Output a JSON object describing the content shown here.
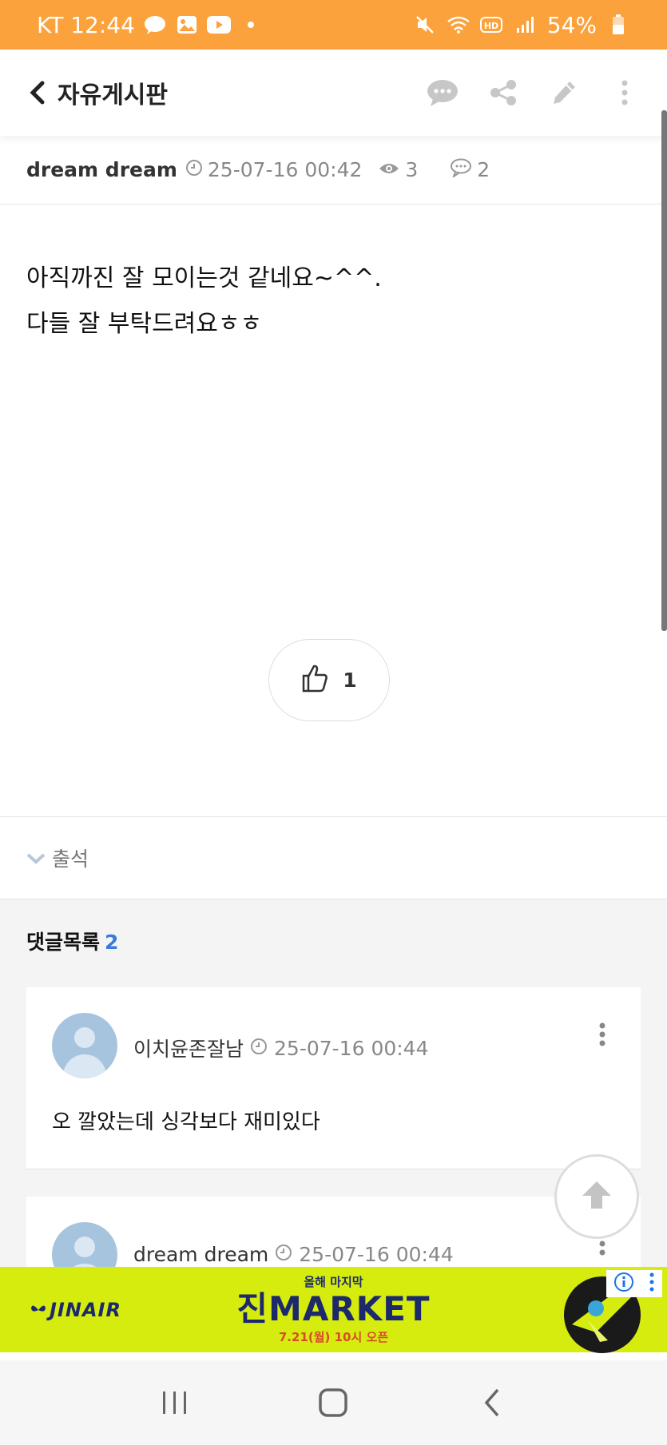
{
  "status_bar": {
    "carrier_time": "KT 12:44",
    "battery": "54%"
  },
  "header": {
    "title": "자유게시판"
  },
  "post": {
    "author": "dream dream",
    "datetime": "25-07-16 00:42",
    "views": "3",
    "comments": "2",
    "lines": [
      "아직까진 잘 모이는것 같네요~^^.",
      "다들 잘 부탁드려요ㅎㅎ"
    ],
    "likes": "1",
    "tag": "출석"
  },
  "comments_section": {
    "title": "댓글목록",
    "count": "2",
    "items": [
      {
        "author": "이치윤존잘남",
        "datetime": "25-07-16 00:44",
        "text": "오 깔았는데 싱각보다 재미있다"
      },
      {
        "author": "dream dream",
        "datetime": "25-07-16 00:44"
      }
    ]
  },
  "ad": {
    "brand": "JINAIR",
    "subtitle": "올해 마지막",
    "headline": "진MARKET",
    "date_text": "7.21(월) 10시 오픈"
  },
  "colors": {
    "status_bar": "#fba23c",
    "accent_count": "#3a7bd5",
    "ad_background": "#d6ec0f"
  }
}
